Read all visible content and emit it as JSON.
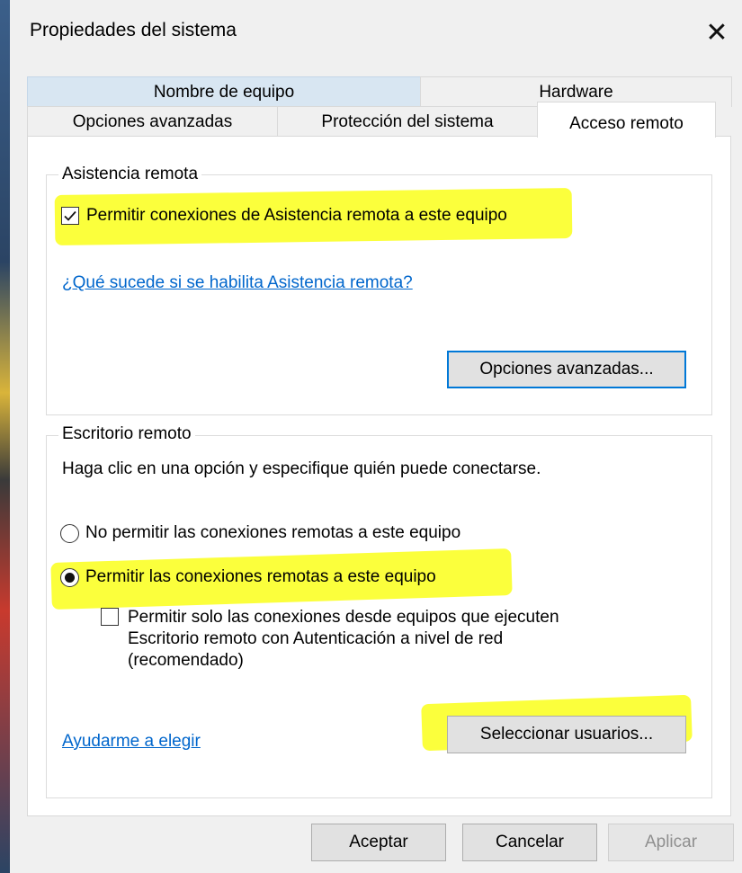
{
  "window": {
    "title": "Propiedades del sistema",
    "close_glyph": "✕"
  },
  "tabs": {
    "back_row": [
      "Nombre de equipo",
      "Hardware"
    ],
    "front_row": [
      "Opciones avanzadas",
      "Protección del sistema",
      "Acceso remoto"
    ],
    "active": "Acceso remoto"
  },
  "remote_assistance": {
    "group_label": "Asistencia remota",
    "checkbox_label": "Permitir conexiones de Asistencia remota a este equipo",
    "checkbox_checked": true,
    "help_link": "¿Qué sucede si se habilita Asistencia remota?",
    "advanced_button": "Opciones avanzadas..."
  },
  "remote_desktop": {
    "group_label": "Escritorio remoto",
    "instruction": "Haga clic en una opción y especifique quién puede conectarse.",
    "radio_deny": "No permitir las conexiones remotas a este equipo",
    "radio_allow": "Permitir las conexiones remotas a este equipo",
    "selected": "allow",
    "nla_line1": "Permitir solo las conexiones desde equipos que ejecuten",
    "nla_line2": "Escritorio remoto con Autenticación a nivel de red",
    "nla_line3": "(recomendado)",
    "nla_checked": false,
    "help_link": "Ayudarme a elegir",
    "select_users_button": "Seleccionar usuarios..."
  },
  "footer": {
    "ok": "Aceptar",
    "cancel": "Cancelar",
    "apply": "Aplicar"
  },
  "colors": {
    "highlight": "#fbff32",
    "link": "#0066cc",
    "focus_border": "#0078d7"
  },
  "icons": {
    "close": "close-icon",
    "checkmark": "checkmark-icon"
  }
}
